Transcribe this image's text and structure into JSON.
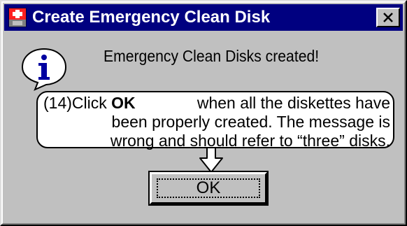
{
  "window": {
    "title": "Create Emergency Clean Disk",
    "colors": {
      "face": "#c0c0c0",
      "titlebar": "#000080",
      "title_text": "#ffffff"
    }
  },
  "icons": {
    "app": "first-aid-icon",
    "close": "close-icon",
    "info": "information-icon",
    "arrow": "down-arrow-icon"
  },
  "dialog": {
    "message": "Emergency Clean Disks created!",
    "ok_label": "OK"
  },
  "callout": {
    "number": "(14)",
    "line1_before": "Click ",
    "line1_bold": "OK",
    "line1_after": " when all the diskettes have",
    "line2": "been properly created. The message is",
    "line3": "wrong and should refer to “three” disks."
  }
}
